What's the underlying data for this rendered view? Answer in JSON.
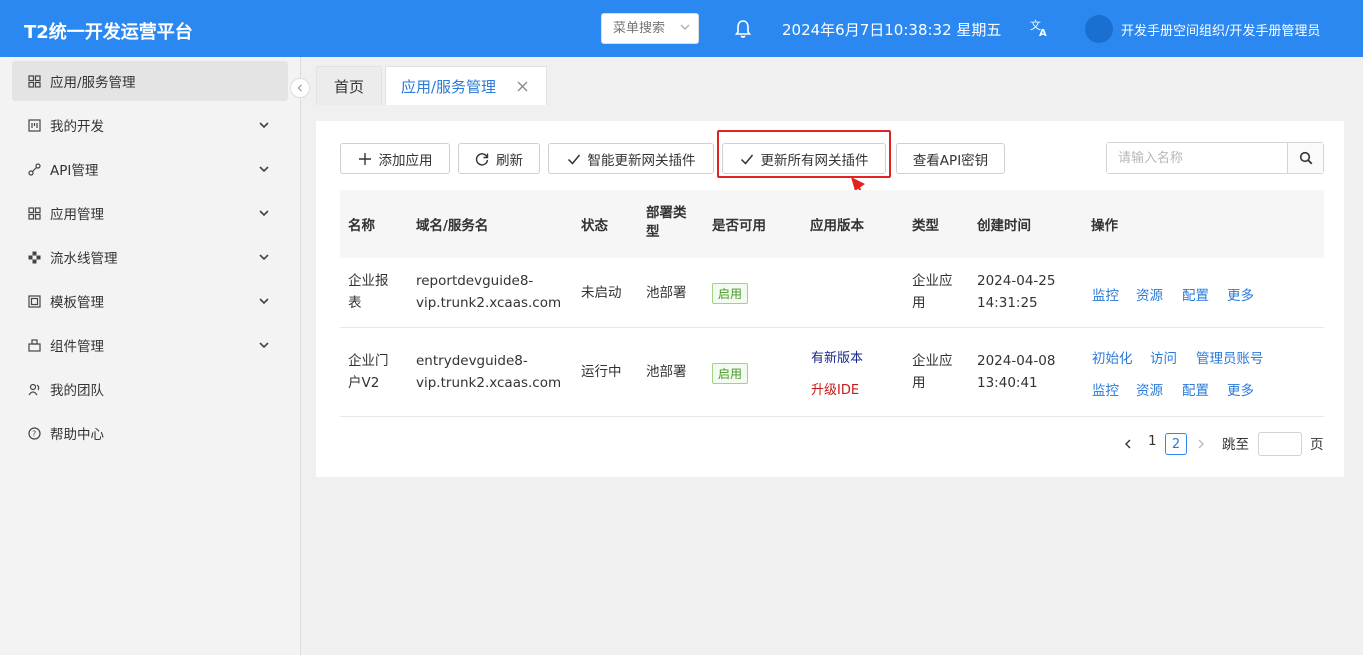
{
  "header": {
    "brand": "T2统一开发运营平台",
    "menu_search_placeholder": "菜单搜索",
    "datetime": "2024年6月7日10:38:32 星期五",
    "user": "开发手册空间组织/开发手册管理员",
    "bg_color": "#2a88f0"
  },
  "sidebar": {
    "items": [
      {
        "label": "应用/服务管理",
        "icon": "app-grid-icon",
        "active": true
      },
      {
        "label": "我的开发",
        "icon": "dev-icon",
        "expandable": true
      },
      {
        "label": "API管理",
        "icon": "api-icon",
        "expandable": true
      },
      {
        "label": "应用管理",
        "icon": "apps-icon",
        "expandable": true
      },
      {
        "label": "流水线管理",
        "icon": "pipeline-icon",
        "expandable": true
      },
      {
        "label": "模板管理",
        "icon": "template-icon",
        "expandable": true
      },
      {
        "label": "组件管理",
        "icon": "component-icon",
        "expandable": true
      },
      {
        "label": "我的团队",
        "icon": "team-icon"
      },
      {
        "label": "帮助中心",
        "icon": "help-icon"
      }
    ]
  },
  "tabs": {
    "home": "首页",
    "current": "应用/服务管理"
  },
  "toolbar": {
    "add": "添加应用",
    "refresh": "刷新",
    "smart_update": "智能更新网关插件",
    "update_all": "更新所有网关插件",
    "view_key": "查看API密钥",
    "search_placeholder": "请输入名称"
  },
  "table": {
    "headers": {
      "name": "名称",
      "domain": "域名/服务名",
      "status": "状态",
      "deploy_type_1": "部署类",
      "deploy_type_2": "型",
      "available": "是否可用",
      "version": "应用版本",
      "type": "类型",
      "created": "创建时间",
      "ops": "操作"
    },
    "rows": [
      {
        "name_1": "企业报",
        "name_2": "表",
        "domain_1": "reportdevguide8-",
        "domain_2": "vip.trunk2.xcaas.com",
        "status": "未启动",
        "deploy": "池部署",
        "available": "启用",
        "type_1": "企业应",
        "type_2": "用",
        "created_1": "2024-04-25",
        "created_2": "14:31:25",
        "ops": [
          "监控",
          "资源",
          "配置",
          "更多"
        ]
      },
      {
        "name_1": "企业门",
        "name_2": "户V2",
        "domain_1": "entrydevguide8-",
        "domain_2": "vip.trunk2.xcaas.com",
        "status": "运行中",
        "deploy": "池部署",
        "available": "启用",
        "version_new": "有新版本",
        "version_upgrade": "升级IDE",
        "type_1": "企业应",
        "type_2": "用",
        "created_1": "2024-04-08",
        "created_2": "13:40:41",
        "ops_top": [
          "初始化",
          "访问",
          "管理员账号"
        ],
        "ops": [
          "监控",
          "资源",
          "配置",
          "更多"
        ]
      }
    ]
  },
  "pagination": {
    "page1": "1",
    "current": "2",
    "jump_label": "跳至",
    "page_suffix": "页"
  }
}
